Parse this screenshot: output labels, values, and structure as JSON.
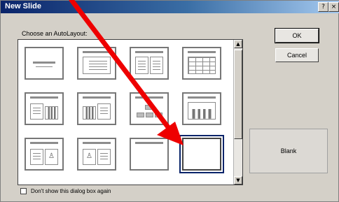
{
  "dialog": {
    "title": "New Slide",
    "help_glyph": "?",
    "close_glyph": "×"
  },
  "list": {
    "label": "Choose an AutoLayout:",
    "scroll_up_glyph": "▲",
    "scroll_down_glyph": "▼",
    "selected_layout": "Blank"
  },
  "buttons": {
    "ok": "OK",
    "cancel": "Cancel"
  },
  "preview": {
    "label": "Blank"
  },
  "dont_show": {
    "checked": false,
    "label": "Don't show this dialog box again"
  },
  "annotation": {
    "arrow_color": "#ee0000"
  }
}
